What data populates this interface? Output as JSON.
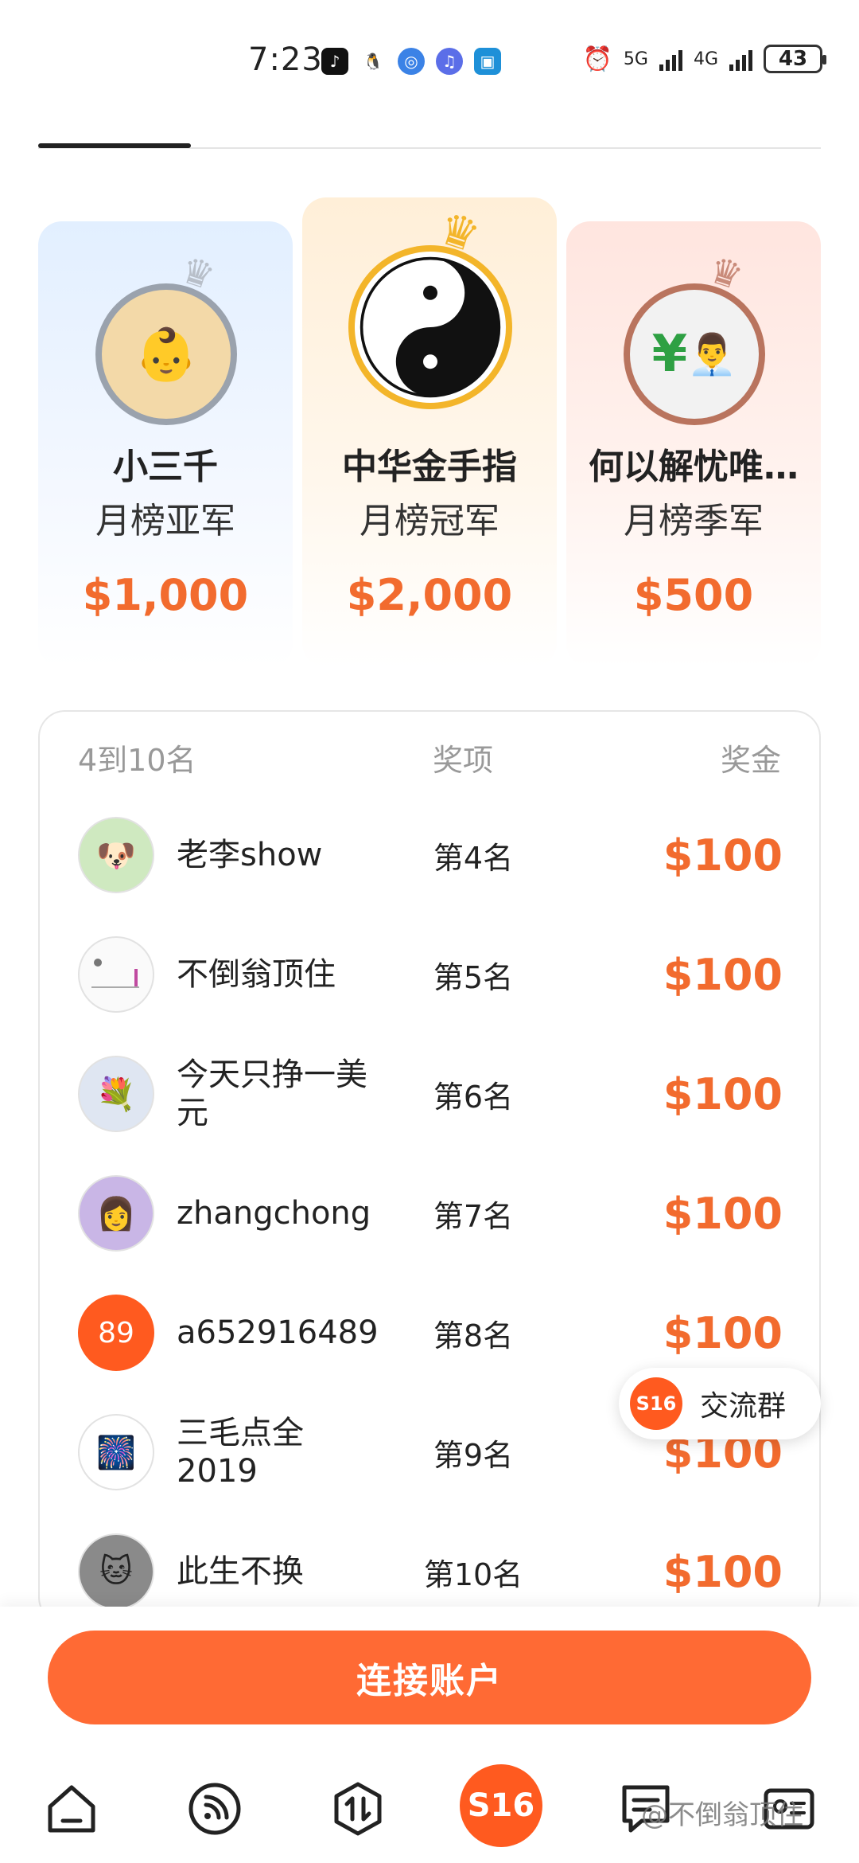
{
  "status_bar": {
    "time": "7:23",
    "network_1": "5G",
    "network_2": "4G",
    "battery": "43"
  },
  "podium": {
    "second": {
      "name": "小三千",
      "rank": "月榜亚军",
      "prize": "$1,000"
    },
    "first": {
      "name": "中华金手指",
      "rank": "月榜冠军",
      "prize": "$2,000"
    },
    "third": {
      "name": "何以解忧唯…",
      "rank": "月榜季军",
      "prize": "$500"
    }
  },
  "list": {
    "header": {
      "rank": "4到10名",
      "award": "奖项",
      "prize": "奖金"
    },
    "rows": [
      {
        "name": "老李show",
        "award": "第4名",
        "prize": "$100"
      },
      {
        "name": "不倒翁顶住",
        "award": "第5名",
        "prize": "$100"
      },
      {
        "name": "今天只挣一美元",
        "award": "第6名",
        "prize": "$100"
      },
      {
        "name": "zhangchong",
        "award": "第7名",
        "prize": "$100"
      },
      {
        "name": "a652916489",
        "award": "第8名",
        "prize": "$100",
        "avatar_text": "89"
      },
      {
        "name": "三毛点全2019",
        "award": "第9名",
        "prize": "$100"
      },
      {
        "name": "此生不换",
        "award": "第10名",
        "prize": "$100"
      }
    ]
  },
  "float_group": {
    "icon_text": "S16",
    "label": "交流群"
  },
  "cta": {
    "label": "连接账户"
  },
  "bottom_nav": {
    "center_label": "S16"
  },
  "watermark": "@不倒翁顶住",
  "colors": {
    "accent": "#ff6a34",
    "prize": "#f26b2e"
  }
}
